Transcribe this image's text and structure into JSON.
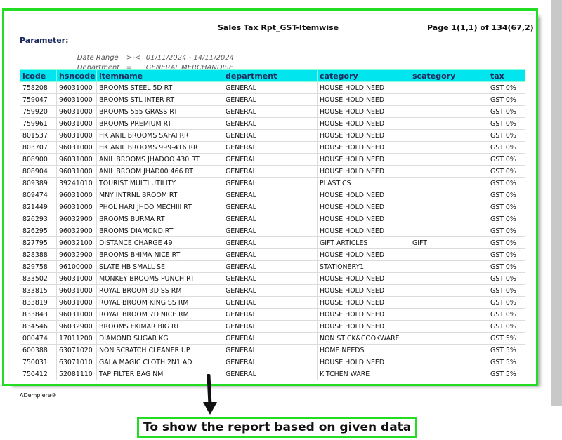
{
  "report": {
    "title": "Sales Tax Rpt_GST-Itemwise",
    "page_info": "Page 1(1,1) of 134(67,2)",
    "parameter_label": "Parameter:",
    "params": [
      {
        "label": "Date Range",
        "op": ">-<",
        "value": "01/11/2024 - 14/11/2024"
      },
      {
        "label": "Department",
        "op": "=",
        "value": "GENERAL MERCHANDISE"
      }
    ],
    "columns": [
      "icode",
      "hsncode",
      "itemname",
      "department",
      "category",
      "scategory",
      "tax"
    ],
    "rows": [
      [
        "758208",
        "96031000",
        "BROOMS STEEL 5D RT",
        "GENERAL",
        "HOUSE HOLD NEED",
        "",
        "GST 0%"
      ],
      [
        "759047",
        "96031000",
        "BROOMS STL INTER RT",
        "GENERAL",
        "HOUSE HOLD NEED",
        "",
        "GST 0%"
      ],
      [
        "759920",
        "96031000",
        "BROOMS 555 GRASS RT",
        "GENERAL",
        "HOUSE HOLD NEED",
        "",
        "GST 0%"
      ],
      [
        "759961",
        "96031000",
        "BROOMS PREMIUM RT",
        "GENERAL",
        "HOUSE HOLD NEED",
        "",
        "GST 0%"
      ],
      [
        "801537",
        "96031000",
        "HK ANIL BROOMS SAFAI RR",
        "GENERAL",
        "HOUSE HOLD NEED",
        "",
        "GST 0%"
      ],
      [
        "803707",
        "96031000",
        "HK ANIL BROOMS 999-416 RR",
        "GENERAL",
        "HOUSE HOLD NEED",
        "",
        "GST 0%"
      ],
      [
        "808900",
        "96031000",
        "ANIL BROOMS JHADOO 430 RT",
        "GENERAL",
        "HOUSE HOLD NEED",
        "",
        "GST 0%"
      ],
      [
        "808904",
        "96031000",
        "ANIL BROOM  JHAD00 466 RT",
        "GENERAL",
        "HOUSE HOLD NEED",
        "",
        "GST 0%"
      ],
      [
        "809389",
        "39241010",
        "TOURIST MULTI UTILITY",
        "GENERAL",
        "PLASTICS",
        "",
        "GST 0%"
      ],
      [
        "809474",
        "96031000",
        "MNY INTRNL BROOM RT",
        "GENERAL",
        "HOUSE HOLD NEED",
        "",
        "GST 0%"
      ],
      [
        "821449",
        "96031000",
        "PHOL HARI JHDO MECHIII RT",
        "GENERAL",
        "HOUSE HOLD NEED",
        "",
        "GST 0%"
      ],
      [
        "826293",
        "96032900",
        "BROOMS BURMA RT",
        "GENERAL",
        "HOUSE HOLD NEED",
        "",
        "GST 0%"
      ],
      [
        "826295",
        "96032900",
        "BROOMS DIAMOND RT",
        "GENERAL",
        "HOUSE HOLD NEED",
        "",
        "GST 0%"
      ],
      [
        "827795",
        "96032100",
        "DISTANCE CHARGE 49",
        "GENERAL",
        "GIFT ARTICLES",
        "GIFT",
        "GST 0%"
      ],
      [
        "828388",
        "96032900",
        "BROOMS BHIMA NICE RT",
        "GENERAL",
        "HOUSE HOLD NEED",
        "",
        "GST 0%"
      ],
      [
        "829758",
        "96100000",
        "SLATE HB SMALL SE",
        "GENERAL",
        "STATIONERY1",
        "",
        "GST 0%"
      ],
      [
        "833502",
        "96031000",
        "MONKEY BROOMS PUNCH RT",
        "GENERAL",
        "HOUSE HOLD NEED",
        "",
        "GST 0%"
      ],
      [
        "833815",
        "96031000",
        "ROYAL BROOM 3D SS RM",
        "GENERAL",
        "HOUSE HOLD NEED",
        "",
        "GST 0%"
      ],
      [
        "833819",
        "96031000",
        "ROYAL BROOM KING SS RM",
        "GENERAL",
        "HOUSE HOLD NEED",
        "",
        "GST 0%"
      ],
      [
        "833843",
        "96031000",
        "ROYAL BROOM 7D NICE RM",
        "GENERAL",
        "HOUSE HOLD NEED",
        "",
        "GST 0%"
      ],
      [
        "834546",
        "96032900",
        "BROOMS EKIMAR BIG RT",
        "GENERAL",
        "HOUSE HOLD NEED",
        "",
        "GST 0%"
      ],
      [
        "000474",
        "17011200",
        "DIAMOND SUGAR KG",
        "GENERAL",
        "NON STICK&COOKWARE",
        "",
        "GST 5%"
      ],
      [
        "600388",
        "63071020",
        "NON SCRATCH CLEANER UP",
        "GENERAL",
        "HOME NEEDS",
        "",
        "GST 5%"
      ],
      [
        "750031",
        "63071010",
        "GALA MAGIC CLOTH 2N1 AD",
        "GENERAL",
        "HOUSE HOLD NEED",
        "",
        "GST 5%"
      ],
      [
        "750412",
        "52081110",
        "TAP FILTER BAG NM",
        "GENERAL",
        "KITCHEN WARE",
        "",
        "GST 5%"
      ]
    ],
    "footer": "ADempiere®"
  },
  "annotation": {
    "caption": "To show the report based on given data",
    "highlight_color": "#22dd22",
    "header_color": "#00e5ee"
  },
  "icons": {
    "arrow": "arrow-down-icon"
  }
}
